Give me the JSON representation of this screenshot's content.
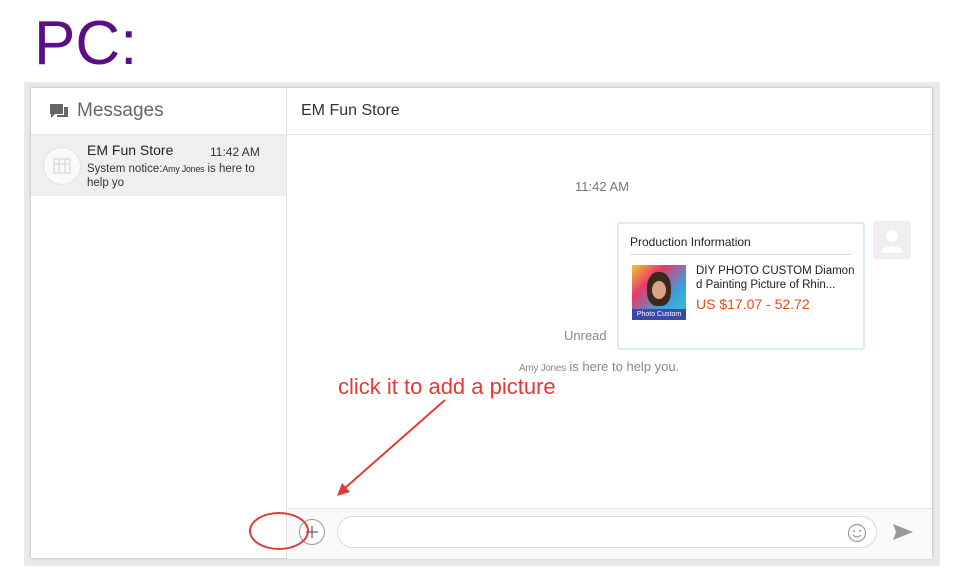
{
  "heading": "PC:",
  "sidebar": {
    "title": "Messages",
    "conversations": [
      {
        "name": "EM Fun Store",
        "time": "11:42 AM",
        "preview_prefix": "System notice:",
        "preview_user": "Amy Jones",
        "preview_suffix": " is here to help yo"
      }
    ]
  },
  "chat": {
    "title": "EM Fun Store",
    "timestamp": "11:42 AM",
    "card": {
      "title": "Production Information",
      "image_caption": "Photo Custom",
      "product_name": "DIY PHOTO CUSTOM Diamond Painting Picture of Rhin...",
      "price": "US $17.07 - 52.72"
    },
    "unread_label": "Unread",
    "notice_user": "Amy Jones",
    "notice_text": " is here to help you.",
    "input_placeholder": ""
  },
  "annotation": "click it to add a picture",
  "colors": {
    "heading": "#5b0f86",
    "annotation": "#e53935",
    "price": "#e64a19"
  },
  "icons": [
    "messages-icon",
    "store-icon",
    "user-avatar-icon",
    "plus-icon",
    "emoji-icon",
    "send-icon"
  ]
}
